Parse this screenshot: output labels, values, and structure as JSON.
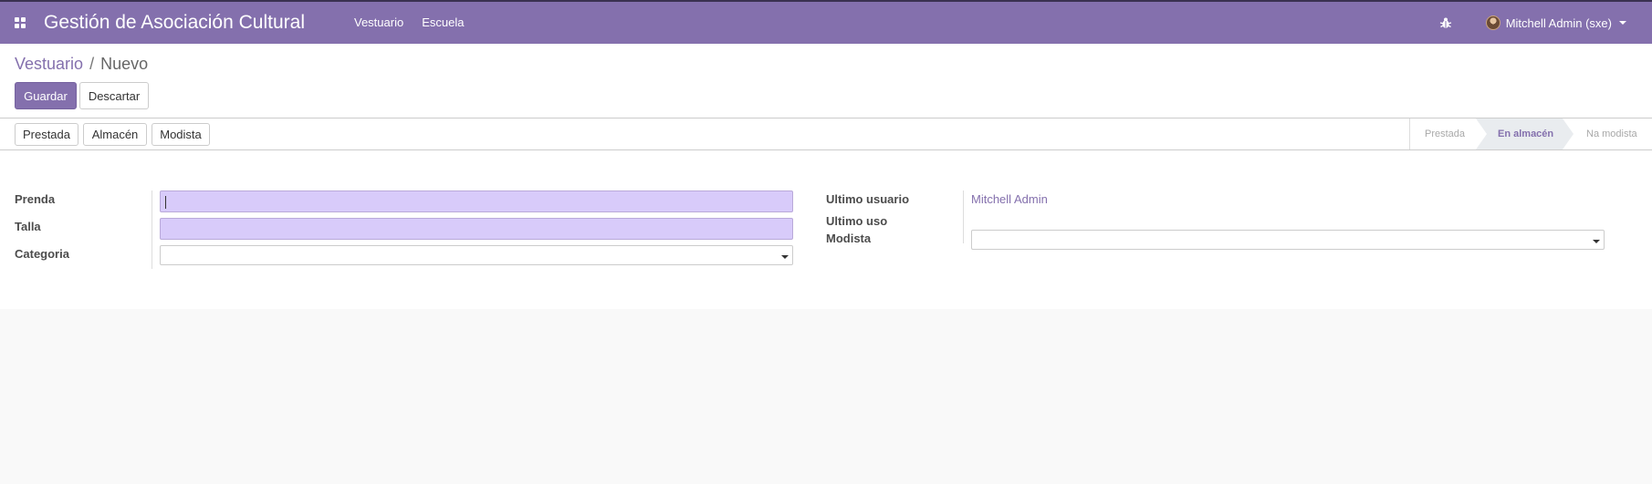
{
  "navbar": {
    "app_title": "Gestión de Asociación Cultural",
    "menu_items": [
      "Vestuario",
      "Escuela"
    ],
    "user_name": "Mitchell Admin (sxe)",
    "accent_color": "#8470ad"
  },
  "breadcrumb": {
    "parent": "Vestuario",
    "separator": "/",
    "current": "Nuevo"
  },
  "actions": {
    "save_label": "Guardar",
    "discard_label": "Descartar"
  },
  "statusbar": {
    "buttons": [
      "Prestada",
      "Almacén",
      "Modista"
    ],
    "stages": [
      {
        "label": "Prestada",
        "active": false
      },
      {
        "label": "En almacén",
        "active": true
      },
      {
        "label": "Na modista",
        "active": false
      }
    ]
  },
  "form": {
    "left": {
      "prenda_label": "Prenda",
      "prenda_value": "",
      "talla_label": "Talla",
      "talla_value": "",
      "categoria_label": "Categoria",
      "categoria_value": ""
    },
    "right": {
      "ultimo_usuario_label": "Ultimo usuario",
      "ultimo_usuario_value": "Mitchell Admin",
      "ultimo_uso_label": "Ultimo uso",
      "modista_label": "Modista",
      "modista_value": ""
    }
  }
}
